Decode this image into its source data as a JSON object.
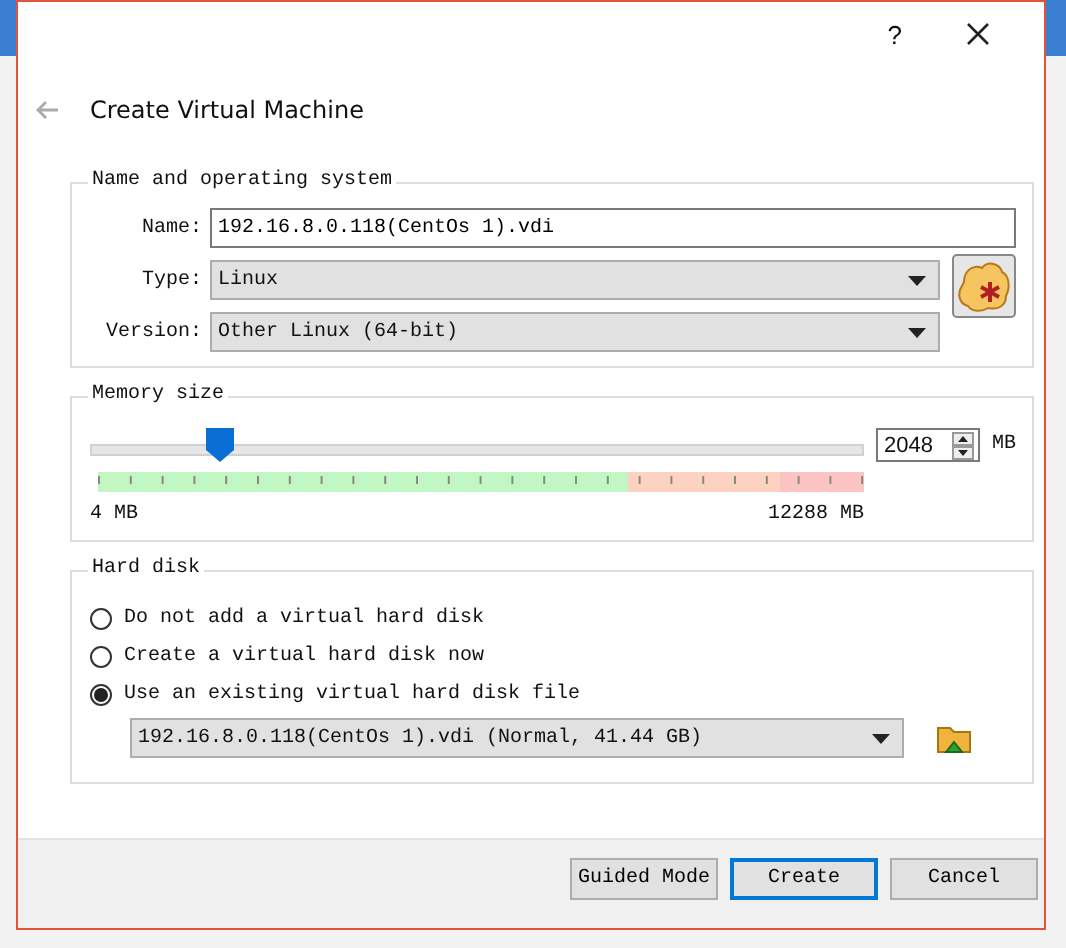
{
  "window": {
    "help": "?",
    "title": "Create Virtual Machine"
  },
  "name_os": {
    "legend": "Name and operating system",
    "fields": [
      {
        "kind": "text",
        "label": "Name:",
        "value": "192.16.8.0.118(CentOs 1).vdi"
      },
      {
        "kind": "combo",
        "label": "Type:",
        "value": "Linux"
      },
      {
        "kind": "combo",
        "label": "Version:",
        "value": "Other Linux (64-bit)"
      }
    ]
  },
  "memory": {
    "legend": "Memory size",
    "level": 0.167,
    "value": "2048",
    "unit": "MB",
    "min_label": "4 MB",
    "max_label": "12288 MB"
  },
  "hard_disk": {
    "legend": "Hard disk",
    "options": [
      {
        "label": "Do not add a virtual hard disk",
        "selected": false
      },
      {
        "label": "Create a virtual hard disk now",
        "selected": false
      },
      {
        "label": "Use an existing virtual hard disk file",
        "selected": true
      }
    ],
    "file": "192.16.8.0.118(CentOs 1).vdi (Normal, 41.44 GB)"
  },
  "buttons": [
    {
      "label": "Guided Mode",
      "default": false
    },
    {
      "label": "Create",
      "default": true
    },
    {
      "label": "Cancel",
      "default": false
    }
  ]
}
